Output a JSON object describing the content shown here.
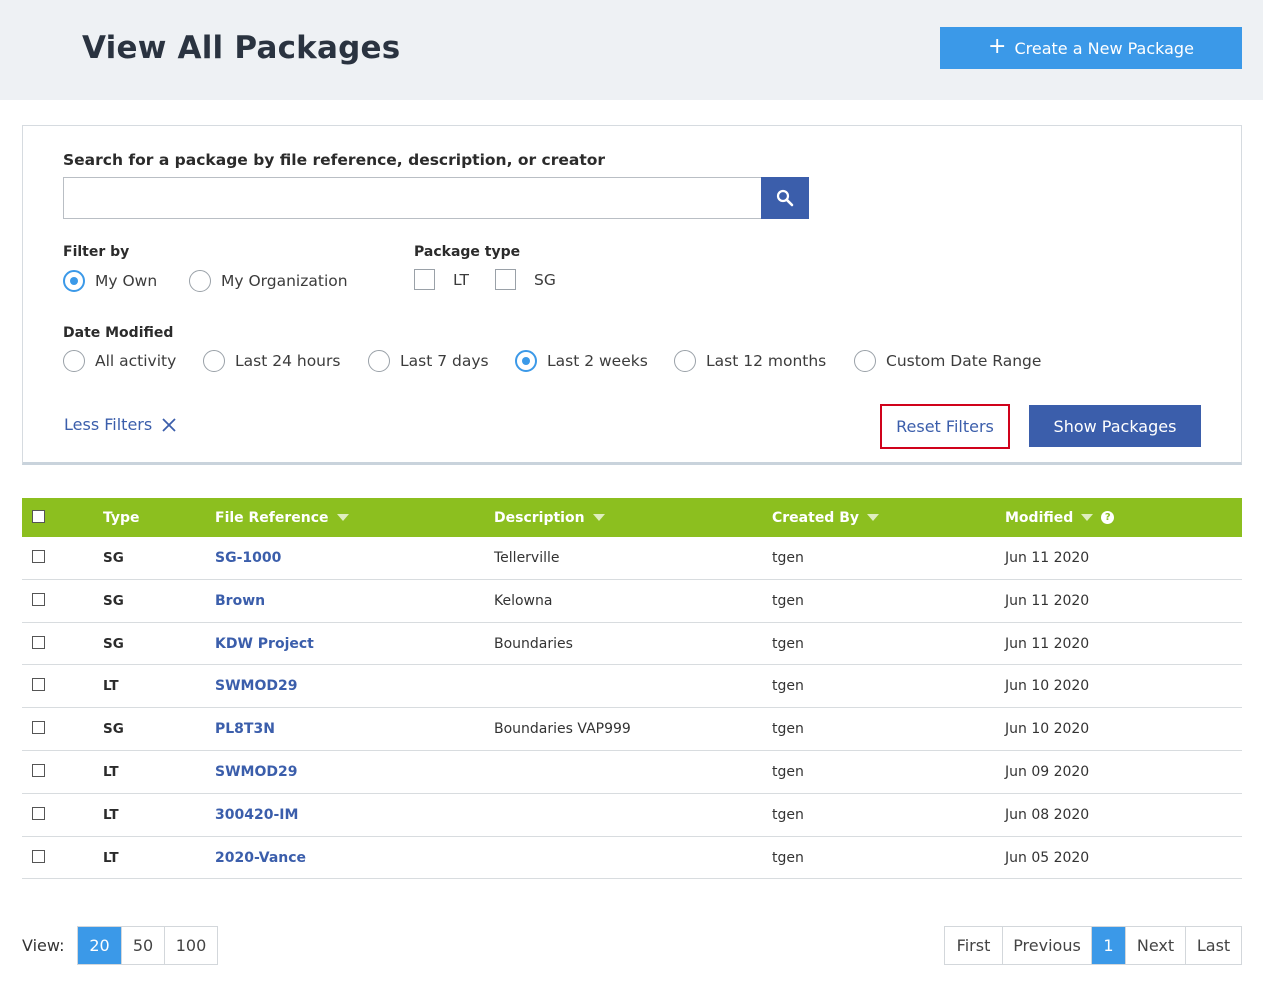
{
  "header": {
    "title": "View All Packages",
    "create_label": "Create a New Package"
  },
  "search": {
    "label": "Search for a package by file reference, description, or creator",
    "value": "",
    "placeholder": ""
  },
  "filter_by": {
    "label": "Filter by",
    "options": [
      "My Own",
      "My Organization"
    ],
    "selected": "My Own"
  },
  "package_type": {
    "label": "Package type",
    "options": [
      "LT",
      "SG"
    ]
  },
  "date_modified": {
    "label": "Date Modified",
    "options": [
      "All activity",
      "Last 24 hours",
      "Last 7 days",
      "Last 2 weeks",
      "Last 12 months",
      "Custom Date Range"
    ],
    "selected": "Last 2 weeks"
  },
  "actions": {
    "less_filters": "Less Filters",
    "reset": "Reset Filters",
    "show": "Show Packages"
  },
  "table": {
    "columns": [
      "Type",
      "File Reference",
      "Description",
      "Created By",
      "Modified"
    ],
    "rows": [
      {
        "type": "SG",
        "ref": "SG-1000",
        "desc": "Tellerville",
        "by": "tgen",
        "modified": "Jun 11 2020"
      },
      {
        "type": "SG",
        "ref": "Brown",
        "desc": "Kelowna",
        "by": "tgen",
        "modified": "Jun 11 2020"
      },
      {
        "type": "SG",
        "ref": "KDW Project",
        "desc": "Boundaries",
        "by": "tgen",
        "modified": "Jun 11 2020"
      },
      {
        "type": "LT",
        "ref": "SWMOD29",
        "desc": "",
        "by": "tgen",
        "modified": "Jun 10 2020"
      },
      {
        "type": "SG",
        "ref": "PL8T3N",
        "desc": "Boundaries VAP999",
        "by": "tgen",
        "modified": "Jun 10 2020"
      },
      {
        "type": "LT",
        "ref": "SWMOD29",
        "desc": "",
        "by": "tgen",
        "modified": "Jun 09 2020"
      },
      {
        "type": "LT",
        "ref": "300420-IM",
        "desc": "",
        "by": "tgen",
        "modified": "Jun 08 2020"
      },
      {
        "type": "LT",
        "ref": "2020-Vance",
        "desc": "",
        "by": "tgen",
        "modified": "Jun 05 2020"
      }
    ]
  },
  "view": {
    "label": "View:",
    "options": [
      "20",
      "50",
      "100"
    ],
    "selected": "20"
  },
  "pagination": {
    "first": "First",
    "previous": "Previous",
    "current": "1",
    "next": "Next",
    "last": "Last"
  },
  "colors": {
    "accent_blue": "#3b99e8",
    "navy": "#3b5eab",
    "header_green": "#8cbf1f",
    "highlight_red": "#d0021b"
  },
  "icons": [
    "plus-icon",
    "search-icon",
    "close-icon",
    "sort-caret-icon",
    "help-icon"
  ]
}
